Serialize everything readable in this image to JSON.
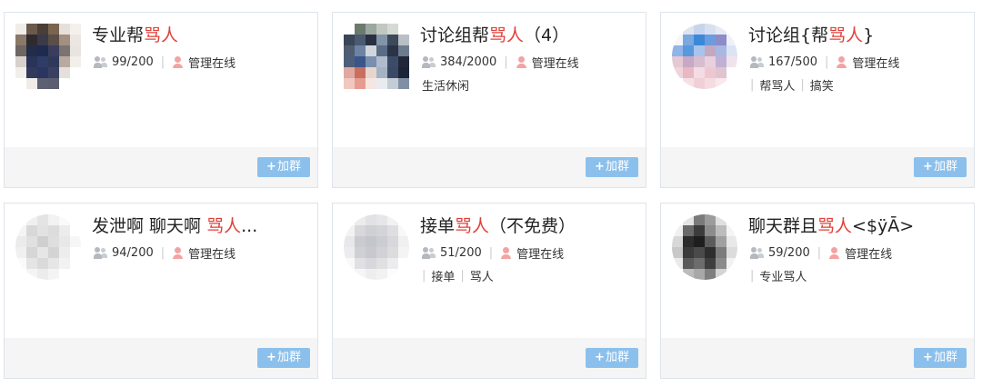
{
  "join_label": "加群",
  "join_plus": "+",
  "groups": [
    {
      "title_prefix": "专业帮",
      "title_highlight": "骂人",
      "title_suffix": "",
      "members": "99/200",
      "admin": "管理在线",
      "tags_style": "none",
      "tags": [],
      "avatar_palette": [
        "#f0ece8",
        "#6b5a4c",
        "#4a3e36",
        "#7a6450",
        "#e6e0dc",
        "#f4f0ec",
        "#8a7868",
        "#2e2a2e",
        "#3b3a4a",
        "#5a4e48",
        "#a49080",
        "#ece6e2",
        "#6e6660",
        "#232c48",
        "#1e2a50",
        "#3a3e5c",
        "#7c7470",
        "#e8e4e0",
        "#d8d0cc",
        "#2a3458",
        "#2f3c66",
        "#30385a",
        "#b8aaa0",
        "#f2eeea",
        "#f2eeea",
        "#313a5c",
        "#2c3560",
        "#3a4060",
        "#e6e0dc",
        "#ffffff",
        "#ffffff",
        "#f0ece8",
        "#5c6070",
        "#5a5e70",
        "#ffffff",
        "#ffffff"
      ],
      "avatar_round": false
    },
    {
      "title_prefix": "讨论组帮",
      "title_highlight": "骂人",
      "title_suffix": "（4）",
      "members": "384/2000",
      "admin": "管理在线",
      "tags_style": "plain",
      "tags": [
        "生活休闲"
      ],
      "avatar_palette": [
        "#ffffff",
        "#6c7a6e",
        "#9aa8a0",
        "#c2c8c0",
        "#d6dad4",
        "#ffffff",
        "#3a4656",
        "#4a5a70",
        "#2a3042",
        "#8294a8",
        "#3c4a5c",
        "#b8c0c6",
        "#505c72",
        "#6e82a4",
        "#d0d6dc",
        "#5a6c86",
        "#2a3446",
        "#6c7c8e",
        "#4c5e7a",
        "#3a5688",
        "#7a8eb0",
        "#b0bccc",
        "#3c4c68",
        "#22283a",
        "#e0a8a0",
        "#c87060",
        "#e8d6cc",
        "#a4b2c4",
        "#3a4a66",
        "#1c2438",
        "#f0c8c0",
        "#e89c90",
        "#f4e6e0",
        "#e8ecf0",
        "#c4ccd6",
        "#8090a4"
      ],
      "avatar_round": false
    },
    {
      "title_prefix": "讨论组{帮",
      "title_highlight": "骂人",
      "title_suffix": "}",
      "members": "167/500",
      "admin": "管理在线",
      "tags_style": "bar",
      "tags": [
        "帮骂人",
        "搞笑"
      ],
      "avatar_palette": [
        "#ffffff",
        "#e0e4f0",
        "#c8d4ec",
        "#d8e0f0",
        "#e6eaf4",
        "#ffffff",
        "#f4f6fa",
        "#7aa8e0",
        "#3c88d8",
        "#6c9ce0",
        "#8c8cc8",
        "#eef0f8",
        "#8eb4e8",
        "#5898dc",
        "#a8c4ec",
        "#c4a8c0",
        "#a8b8e0",
        "#dce4f4",
        "#e4c8d4",
        "#c8a8c4",
        "#d8bcd0",
        "#e8d0dc",
        "#c0b0d4",
        "#f0e4ec",
        "#f0d4dc",
        "#e8b8c4",
        "#f4dce4",
        "#eec8d0",
        "#e0c4d0",
        "#ffffff",
        "#ffffff",
        "#f6e0e6",
        "#f0d0d8",
        "#f4dce2",
        "#fae8ec",
        "#ffffff"
      ],
      "avatar_round": true
    },
    {
      "title_prefix": "发泄啊 聊天啊 ",
      "title_highlight": "骂人",
      "title_suffix": "...",
      "members": "94/200",
      "admin": "管理在线",
      "tags_style": "none",
      "tags": [],
      "avatar_palette": [
        "#ffffff",
        "#f0f0f0",
        "#e4e4e4",
        "#f2f2f2",
        "#fafafa",
        "#ffffff",
        "#f4f4f4",
        "#d8d8d8",
        "#e2e2e2",
        "#dcdcdc",
        "#ececec",
        "#ffffff",
        "#ebebeb",
        "#e0e0e0",
        "#cfcfcf",
        "#dedede",
        "#e8e8e8",
        "#f6f6f6",
        "#f0f0f0",
        "#d6d6d6",
        "#e6e6e6",
        "#d4d4d4",
        "#ededed",
        "#ffffff",
        "#fafafa",
        "#e4e4e4",
        "#dadada",
        "#e6e6e6",
        "#f2f2f2",
        "#ffffff",
        "#ffffff",
        "#f4f4f4",
        "#ececec",
        "#f4f4f4",
        "#ffffff",
        "#ffffff"
      ],
      "avatar_round": true
    },
    {
      "title_prefix": "接单",
      "title_highlight": "骂人",
      "title_suffix": "（不免费）",
      "members": "51/200",
      "admin": "管理在线",
      "tags_style": "bar",
      "tags": [
        "接单",
        "骂人"
      ],
      "avatar_palette": [
        "#ffffff",
        "#ececec",
        "#e2e2e6",
        "#e6e6e8",
        "#f2f2f2",
        "#ffffff",
        "#f2f2f2",
        "#d8d8dc",
        "#cfd0d4",
        "#d4d4d8",
        "#dedee0",
        "#f8f8f8",
        "#e8e8ea",
        "#cacbd0",
        "#c4c6cc",
        "#cccdd2",
        "#d8d8dc",
        "#f0f0f0",
        "#ececee",
        "#d0d0d4",
        "#c8c8ce",
        "#d2d2d6",
        "#dcdcde",
        "#f4f4f4",
        "#f8f8f8",
        "#e0e0e4",
        "#d8d8dc",
        "#e0e0e2",
        "#ececee",
        "#ffffff",
        "#ffffff",
        "#f6f6f6",
        "#eeeeee",
        "#f2f2f2",
        "#fcfcfc",
        "#ffffff"
      ],
      "avatar_round": true
    },
    {
      "title_prefix": "聊天群且",
      "title_highlight": "骂人",
      "title_suffix": "<$ÿĀ>",
      "members": "59/200",
      "admin": "管理在线",
      "tags_style": "bar",
      "tags": [
        "专业骂人"
      ],
      "avatar_palette": [
        "#ffffff",
        "#e4e4e4",
        "#7a7a7a",
        "#9c9c9c",
        "#e0e0e0",
        "#ffffff",
        "#f0f0f0",
        "#6a6a6a",
        "#3c3c3c",
        "#8c8c8c",
        "#bcbcbc",
        "#f4f4f4",
        "#d8d8d8",
        "#2c2c2c",
        "#1e1e1e",
        "#5c5c5c",
        "#a0a0a0",
        "#e8e8e8",
        "#c8c8c8",
        "#3a3a3a",
        "#4a4a4a",
        "#2e2e2e",
        "#7c7c7c",
        "#dcdcdc",
        "#eaeaea",
        "#5a5a5a",
        "#6c6c6c",
        "#3e3e3e",
        "#8a8a8a",
        "#f2f2f2",
        "#ffffff",
        "#bcbcbc",
        "#a8a8a8",
        "#7e7e7e",
        "#d4d4d4",
        "#ffffff"
      ],
      "avatar_round": true
    }
  ]
}
